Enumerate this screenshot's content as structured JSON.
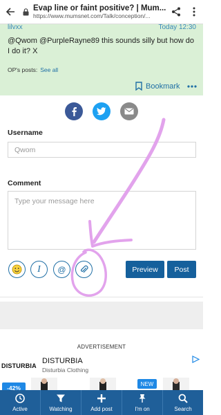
{
  "browser": {
    "page_title": "Evap line or faint positive? | Mum...",
    "url": "https://www.mumsnet.com/Talk/conception/..."
  },
  "post": {
    "username": "lilvxx",
    "time": "Today 12:30",
    "body": "@Qwom @PurpleRayne89 this sounds silly but how do I do it? X",
    "ops_label": "OP's posts:",
    "see_all": "See all",
    "bookmark": "Bookmark"
  },
  "share": {
    "icons": [
      "facebook-icon",
      "twitter-icon",
      "email-icon"
    ]
  },
  "form": {
    "username_label": "Username",
    "username_placeholder": "Qwom",
    "comment_label": "Comment",
    "comment_placeholder": "Type your message here",
    "italic_glyph": "I",
    "at_glyph": "@",
    "preview": "Preview",
    "post": "Post"
  },
  "ad": {
    "label": "ADVERTISEMENT",
    "logo": "DISTURBIA",
    "title": "DISTURBIA",
    "subtitle": "Disturbia Clothing",
    "discount": "-42%",
    "new_tag": "NEW"
  },
  "nav": [
    {
      "label": "Active",
      "icon": "clock-icon"
    },
    {
      "label": "Watching",
      "icon": "filter-icon"
    },
    {
      "label": "Add post",
      "icon": "plus-icon"
    },
    {
      "label": "I'm on",
      "icon": "pin-icon"
    },
    {
      "label": "Search",
      "icon": "search-icon"
    }
  ],
  "colors": {
    "post_bg": "#daf0d6",
    "accent": "#1f6fa5",
    "nav_bg": "#1f5f99",
    "facebook": "#3b5998",
    "twitter": "#1da1f2",
    "email": "#8a8a8a",
    "annotation": "#e2a3ec"
  }
}
